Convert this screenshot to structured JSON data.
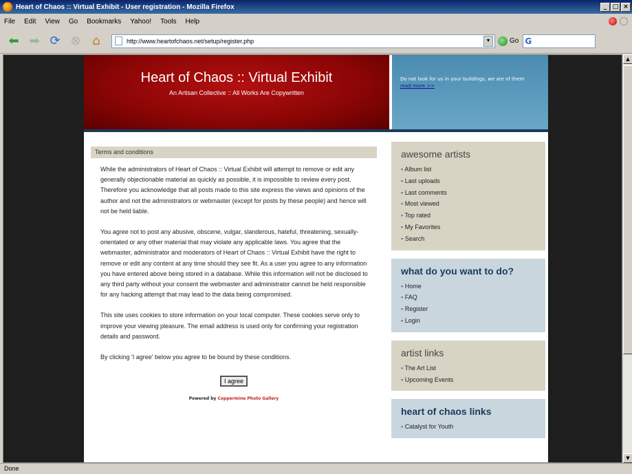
{
  "window": {
    "title": "Heart of Chaos :: Virtual Exhibit - User registration - Mozilla Firefox"
  },
  "menu": [
    "File",
    "Edit",
    "View",
    "Go",
    "Bookmarks",
    "Yahoo!",
    "Tools",
    "Help"
  ],
  "navbar": {
    "url": "http://www.heartofchaos.net/setup/register.php",
    "go_label": "Go"
  },
  "header": {
    "site_title": "Heart of Chaos :: Virtual Exhibit",
    "tagline": "An Artisan Collective :: All Works Are Copywritten",
    "blue_text": "Do not look for us in your buildings, we are of them",
    "blue_link": "read more >>"
  },
  "terms": {
    "heading": "Terms and conditions",
    "p1": "While the administrators of Heart of Chaos :: Virtual Exhibit will attempt to remove or edit any generally objectionable material as quickly as possible, it is impossible to review every post. Therefore you acknowledge that all posts made to this site express the views and opinions of the author and not the administrators or webmaster (except for posts by these people) and hence will not be held liable.",
    "p2": "You agree not to post any abusive, obscene, vulgar, slanderous, hateful, threatening, sexually-orientated or any other material that may violate any applicable laws. You agree that the webmaster, administrator and moderators of Heart of Chaos :: Virtual Exhibit have the right to remove or edit any content at any time should they see fit. As a user you agree to any information you have entered above being stored in a database. While this information will not be disclosed to any third party without your consent the webmaster and administrator cannot be held responsible for any hacking attempt that may lead to the data being compromised.",
    "p3": "This site uses cookies to store information on your local computer. These cookies serve only to improve your viewing pleasure. The email address is used only for confirming your registration details and password.",
    "p4": "By clicking 'I agree' below you agree to be bound by these conditions.",
    "agree": "I agree",
    "powered_prefix": "Powered by",
    "powered_link": "Coppermine Photo Gallery"
  },
  "sidebar": {
    "artists": {
      "title": "awesome artists",
      "items": [
        "Album list",
        "Last uploads",
        "Last comments",
        "Most viewed",
        "Top rated",
        "My Favorites",
        "Search"
      ]
    },
    "todo": {
      "title": "what do you want to do?",
      "items": [
        "Home",
        "FAQ",
        "Register",
        "Login"
      ]
    },
    "artist_links": {
      "title": "artist links",
      "items": [
        "The Art List",
        "Upcoming Events"
      ]
    },
    "hoc_links": {
      "title": "heart of chaos links",
      "items": [
        "Catalyst for Youth"
      ]
    }
  },
  "status": "Done"
}
